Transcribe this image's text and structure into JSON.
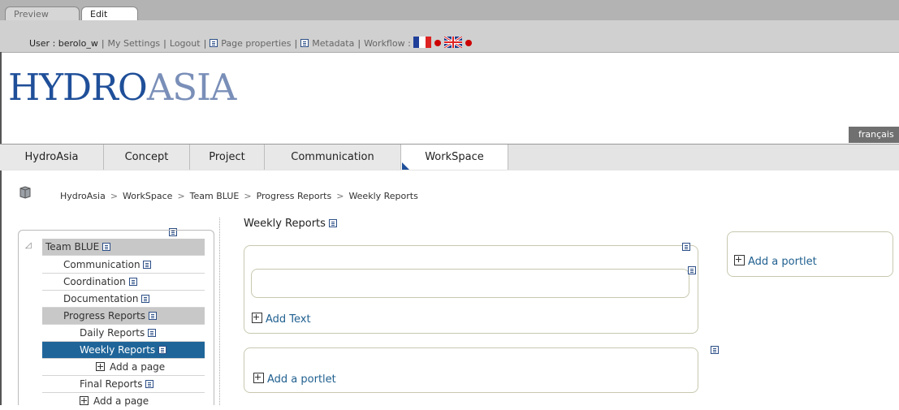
{
  "mode_tabs": {
    "preview": "Preview",
    "edit": "Edit"
  },
  "userbar": {
    "user": "User : berolo_w",
    "my_settings": "My Settings",
    "logout": "Logout",
    "page_properties": "Page properties",
    "metadata": "Metadata",
    "workflow": "Workflow :"
  },
  "logo": {
    "part1": "HYDRO",
    "part2": "ASIA"
  },
  "language": "français",
  "nav": {
    "tabs": [
      "HydroAsia",
      "Concept",
      "Project",
      "Communication",
      "WorkSpace"
    ],
    "active": "WorkSpace"
  },
  "breadcrumb": [
    "HydroAsia",
    "WorkSpace",
    "Team BLUE",
    "Progress Reports",
    "Weekly Reports"
  ],
  "tree": {
    "root": "Team BLUE",
    "items": [
      {
        "label": "Communication",
        "level": 1
      },
      {
        "label": "Coordination",
        "level": 1
      },
      {
        "label": "Documentation",
        "level": 1
      },
      {
        "label": "Progress Reports",
        "level": 1
      },
      {
        "label": "Daily Reports",
        "level": 2
      },
      {
        "label": "Weekly Reports",
        "level": 2
      },
      {
        "label": "Add a page",
        "level": 3
      },
      {
        "label": "Final Reports",
        "level": 2
      },
      {
        "label": "Add a page",
        "level": 2
      }
    ]
  },
  "center": {
    "title": "Weekly Reports",
    "add_text": "Add Text",
    "add_portlet": "Add a portlet"
  },
  "right": {
    "add_portlet": "Add a portlet"
  }
}
